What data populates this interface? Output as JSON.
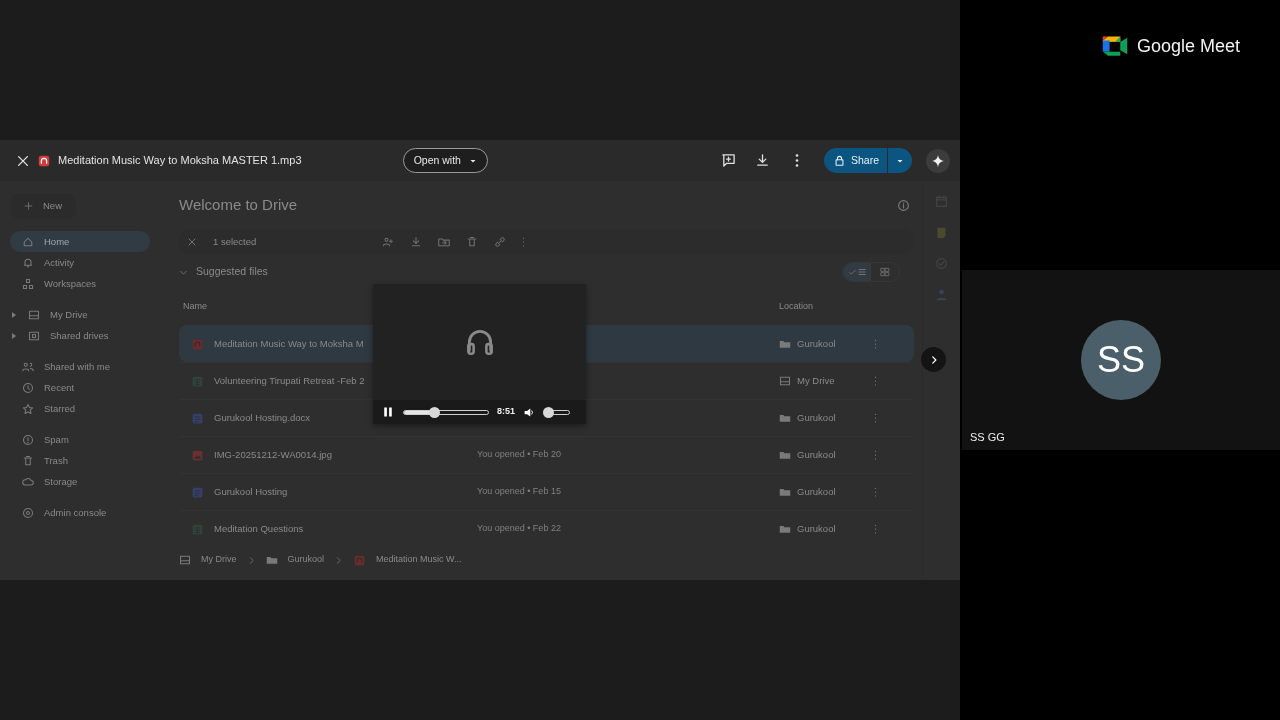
{
  "viewer": {
    "title": "Meditation Music Way to Moksha MASTER 1.mp3",
    "open_with": "Open with",
    "share": "Share"
  },
  "drive": {
    "new": "New",
    "sidebar": [
      [
        {
          "label": "Home",
          "kind": "home",
          "selected": true
        },
        {
          "label": "Activity",
          "kind": "activity",
          "selected": false
        },
        {
          "label": "Workspaces",
          "kind": "workspaces",
          "selected": false
        }
      ],
      [
        {
          "label": "My Drive",
          "kind": "drive",
          "selected": false,
          "expanded": false
        },
        {
          "label": "Shared drives",
          "kind": "shared",
          "selected": false,
          "expanded": false
        }
      ],
      [
        {
          "label": "Shared with me",
          "kind": "people",
          "selected": false
        },
        {
          "label": "Recent",
          "kind": "recent",
          "selected": false
        },
        {
          "label": "Starred",
          "kind": "starred",
          "selected": false
        }
      ],
      [
        {
          "label": "Spam",
          "kind": "spam",
          "selected": false
        },
        {
          "label": "Trash",
          "kind": "trash",
          "selected": false
        },
        {
          "label": "Storage",
          "kind": "storage",
          "selected": false
        }
      ],
      [
        {
          "label": "Admin console",
          "kind": "admin",
          "selected": false
        }
      ]
    ],
    "heading": "Welcome to Drive",
    "selection": "1 selected",
    "section": "Suggested files",
    "views": [
      {
        "kind": "list",
        "selected": true
      },
      {
        "kind": "grid",
        "selected": false
      }
    ],
    "columns": [
      "Name",
      "Location"
    ],
    "files": [
      {
        "name": "Meditation Music Way to Moksha M",
        "kind": "audio",
        "location": {
          "label": "Gurukool",
          "kind": "folder"
        },
        "selected": true
      },
      {
        "name": "Volunteering Tirupati Retreat -Feb 2",
        "kind": "sheet",
        "location": {
          "label": "My Drive",
          "kind": "drive"
        },
        "selected": false
      },
      {
        "name": "Gurukool Hosting.docx",
        "kind": "word",
        "location": {
          "label": "Gurukool",
          "kind": "folder"
        },
        "selected": false
      },
      {
        "name": "IMG-20251212-WA0014.jpg",
        "kind": "image",
        "reason": "You opened • Feb 20",
        "location": {
          "label": "Gurukool",
          "kind": "folder"
        },
        "selected": false
      },
      {
        "name": "Gurukool Hosting",
        "kind": "doc",
        "reason": "You opened • Feb 15",
        "location": {
          "label": "Gurukool",
          "kind": "folder"
        },
        "selected": false
      },
      {
        "name": "Meditation Questions",
        "kind": "sheet",
        "reason": "You opened • Feb 22",
        "location": {
          "label": "Gurukool",
          "kind": "folder"
        },
        "selected": false
      }
    ],
    "breadcrumb": [
      {
        "label": "My Drive",
        "kind": "drive"
      },
      {
        "label": "Gurukool",
        "kind": "folder"
      },
      {
        "label": "Meditation Music W...",
        "kind": "audio"
      }
    ]
  },
  "player": {
    "playing": true,
    "level": 0.36,
    "time": "8:51",
    "volume": {
      "level": 0.12
    }
  },
  "meet": {
    "brand": "Google Meet",
    "participant": {
      "initials": "SS",
      "name": "SS GG"
    }
  }
}
